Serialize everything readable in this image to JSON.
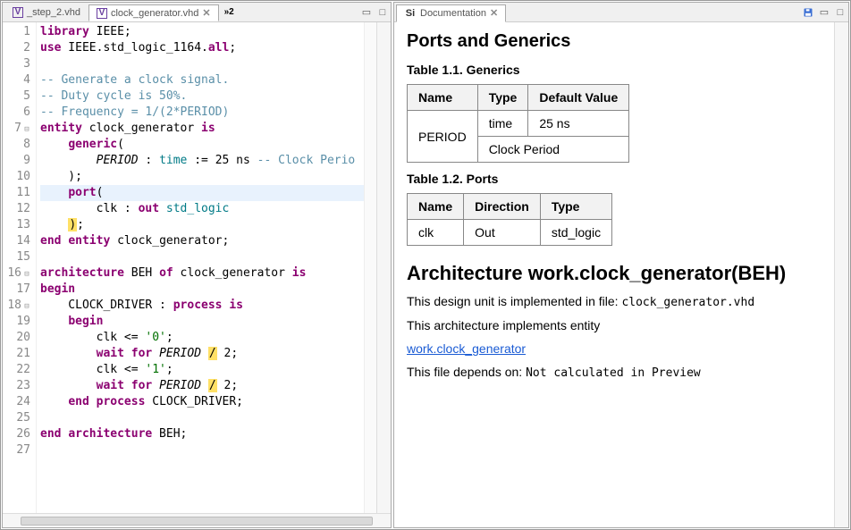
{
  "left": {
    "tabs": [
      {
        "label": "_step_2.vhd",
        "active": false
      },
      {
        "label": "clock_generator.vhd",
        "active": true
      }
    ],
    "overflow": "»2",
    "lines": [
      {
        "n": "1",
        "html": "<span class='kw'>library</span> IEEE;"
      },
      {
        "n": "2",
        "html": "<span class='kw'>use</span> IEEE.std_logic_1164.<span class='kw'>all</span>;"
      },
      {
        "n": "3",
        "html": ""
      },
      {
        "n": "4",
        "html": "<span class='cmt'>-- Generate a clock signal.</span>"
      },
      {
        "n": "5",
        "html": "<span class='cmt'>-- Duty cycle is 50%.</span>"
      },
      {
        "n": "6",
        "html": "<span class='cmt'>-- Frequency = 1/(2*PERIOD)</span>"
      },
      {
        "n": "7",
        "fold": true,
        "html": "<span class='kw'>entity</span> clock_generator <span class='kw'>is</span>"
      },
      {
        "n": "8",
        "html": "    <span class='kw2'>generic</span>("
      },
      {
        "n": "9",
        "html": "        <span class='id' style='font-style:italic'>PERIOD</span> : <span class='type'>time</span> := 25 ns <span class='cmt'>-- Clock Perio</span>"
      },
      {
        "n": "10",
        "html": "    );"
      },
      {
        "n": "11",
        "hl": true,
        "html": "    <span class='kw2'>port</span>("
      },
      {
        "n": "12",
        "html": "        clk : <span class='kw'>out</span> <span class='type'>std_logic</span>"
      },
      {
        "n": "13",
        "html": "    <span class='warn'>)</span>;"
      },
      {
        "n": "14",
        "html": "<span class='kw'>end</span> <span class='kw'>entity</span> clock_generator;"
      },
      {
        "n": "15",
        "html": ""
      },
      {
        "n": "16",
        "fold": true,
        "html": "<span class='kw'>architecture</span> BEH <span class='kw'>of</span> clock_generator <span class='kw'>is</span>"
      },
      {
        "n": "17",
        "html": "<span class='kw'>begin</span>"
      },
      {
        "n": "18",
        "fold": true,
        "html": "    CLOCK_DRIVER : <span class='kw'>process</span> <span class='kw'>is</span>"
      },
      {
        "n": "19",
        "html": "    <span class='kw'>begin</span>"
      },
      {
        "n": "20",
        "html": "        clk &lt;= <span class='str'>'0'</span>;"
      },
      {
        "n": "21",
        "html": "        <span class='kw'>wait</span> <span class='kw'>for</span> <span class='id' style='font-style:italic'>PERIOD</span> <span class='warn'>/</span> 2;"
      },
      {
        "n": "22",
        "html": "        clk &lt;= <span class='str'>'1'</span>;"
      },
      {
        "n": "23",
        "html": "        <span class='kw'>wait</span> <span class='kw'>for</span> <span class='id' style='font-style:italic'>PERIOD</span> <span class='warn'>/</span> 2;"
      },
      {
        "n": "24",
        "html": "    <span class='kw'>end</span> <span class='kw'>process</span> CLOCK_DRIVER;"
      },
      {
        "n": "25",
        "html": ""
      },
      {
        "n": "26",
        "html": "<span class='kw'>end</span> <span class='kw'>architecture</span> BEH;"
      },
      {
        "n": "27",
        "html": ""
      }
    ]
  },
  "right": {
    "tab_label": "Documentation",
    "h2": "Ports and Generics",
    "table1_cap": "Table 1.1. Generics",
    "t1_h1": "Name",
    "t1_h2": "Type",
    "t1_h3": "Default Value",
    "t1_r1c1": "PERIOD",
    "t1_r1c2": "time",
    "t1_r1c3": "25 ns",
    "t1_r2": "Clock Period",
    "table2_cap": "Table 1.2. Ports",
    "t2_h1": "Name",
    "t2_h2": "Direction",
    "t2_h3": "Type",
    "t2_r1c1": "clk",
    "t2_r1c2": "Out",
    "t2_r1c3": "std_logic",
    "arch_h": "Architecture work.clock_generator(BEH)",
    "p1_a": "This design unit is implemented in file: ",
    "p1_b": "clock_generator.vhd",
    "p2": "This architecture implements entity",
    "link": "work.clock_generator",
    "p3_a": "This file depends on: ",
    "p3_b": "Not calculated in Preview"
  }
}
